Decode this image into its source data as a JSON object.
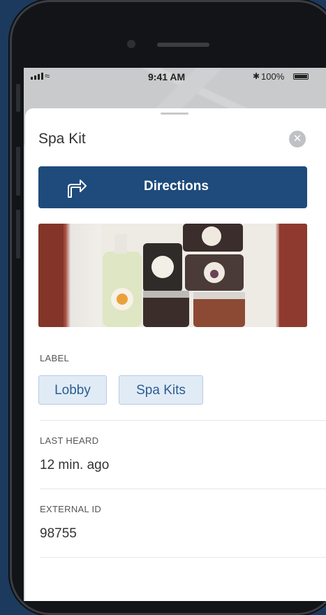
{
  "status_bar": {
    "time": "9:41 AM",
    "battery": "100%"
  },
  "sheet": {
    "title": "Spa Kit",
    "directions_label": "Directions",
    "label_header": "LABEL",
    "labels": [
      "Lobby",
      "Spa Kits"
    ],
    "last_heard_header": "LAST HEARD",
    "last_heard_value": "12 min. ago",
    "external_id_header": "EXTERNAL ID",
    "external_id_value": "98755"
  },
  "icons": {
    "close": "close-icon",
    "directions": "turn-right-arrow-icon"
  },
  "colors": {
    "brand_blue": "#1e4b7c",
    "chip_bg": "#e1ebf5",
    "chip_text": "#2a5d95",
    "background": "#1b3a5e"
  }
}
